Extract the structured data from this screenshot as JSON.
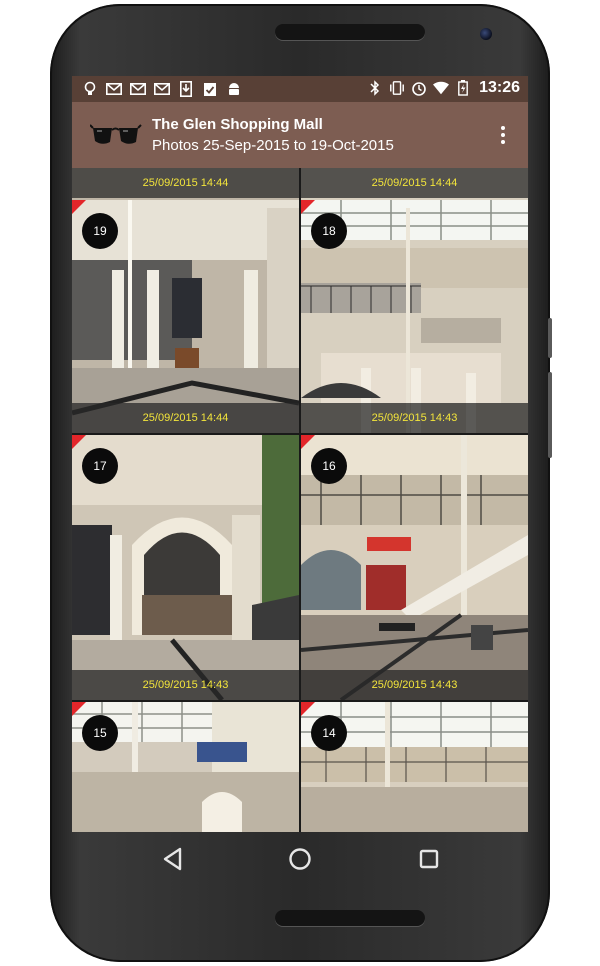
{
  "status_bar": {
    "time": "13:26",
    "left_icons": [
      "lightbulb-icon",
      "gmail-icon",
      "gmail-icon",
      "gmail-icon",
      "download-icon",
      "clipboard-check-icon",
      "android-icon"
    ],
    "right_icons": [
      "bluetooth-icon",
      "vibrate-icon",
      "alarm-icon",
      "wifi-icon",
      "battery-charging-icon"
    ]
  },
  "app_bar": {
    "title": "The Glen Shopping Mall",
    "subtitle": "Photos 25-Sep-2015 to 19-Oct-2015",
    "logo_icon": "sunglasses-icon",
    "menu_icon": "more-vert-icon"
  },
  "grid": {
    "top_row_timestamps": [
      "25/09/2015 14:44",
      "25/09/2015 14:44"
    ],
    "photos": [
      {
        "number": "19",
        "timestamp": "25/09/2015 14:44"
      },
      {
        "number": "18",
        "timestamp": "25/09/2015 14:43"
      },
      {
        "number": "17",
        "timestamp": "25/09/2015 14:43"
      },
      {
        "number": "16",
        "timestamp": "25/09/2015 14:43"
      },
      {
        "number": "15",
        "timestamp": ""
      },
      {
        "number": "14",
        "timestamp": ""
      }
    ]
  },
  "nav_bar": {
    "back_icon": "back-triangle-icon",
    "home_icon": "home-circle-icon",
    "recents_icon": "recents-square-icon"
  },
  "colors": {
    "status_bar": "#584036",
    "app_bar": "#7d5d52",
    "timestamp_text": "#f3e53b",
    "badge_corner": "#e3262a"
  }
}
